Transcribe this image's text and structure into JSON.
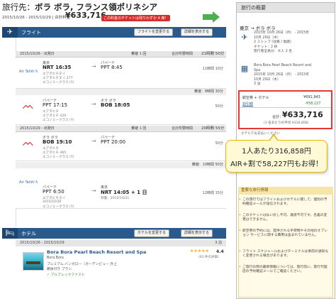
{
  "header": {
    "title_prefix": "旅行先：",
    "title_main": "ボラ ボラ, フランス領ポリネシア",
    "dates": "2015/10/26 - 2015/10/29 | 合計料金",
    "price": "¥633,716",
    "badge": "この料金のチケットは残りわずか 4 席！"
  },
  "flight_section": {
    "label": "フライト",
    "btn_change": "フライトを変更する",
    "btn_details": "詳細を表示する",
    "icon": "airplane-icon"
  },
  "flight_segments": [
    {
      "date": "2015/10/26 - 出発日",
      "stops": "乗継 1 回",
      "total": "合計所要時間",
      "total_time": "21時間 50分",
      "legs": [
        {
          "from_code": "東京",
          "from_time": "NRT 16:35",
          "to_code": "パペーテ",
          "to_time": "PPT 8:45",
          "airline": "エアタヒチヌイ",
          "flight": "エアタヒチヌイ 277",
          "cabin": "エコノミークラス (Y)",
          "duration": "11時間 10分"
        }
      ],
      "layover": "乗継：8時間 30分"
    },
    {
      "legs": [
        {
          "from_code": "パペーテ",
          "from_time": "PPT 17:15",
          "to_code": "ボラ ボラ",
          "to_time": "BOB 18:05",
          "airline": "エアタヒチ",
          "flight": "エアタヒチ 429",
          "cabin": "エコノミークラス (Y)",
          "duration": "50分"
        }
      ]
    },
    {
      "date": "2015/10/29 - 出発日",
      "stops": "乗継 1 回",
      "total": "合計所要時間",
      "total_time": "20時間 55分",
      "legs": [
        {
          "from_code": "ボラ ボラ",
          "from_time": "BOB 19:10",
          "to_code": "パペーテ",
          "to_time": "PPT 20:00",
          "airline": "エアタヒチ",
          "flight": "エアタヒチ 465",
          "cabin": "エコノミークラス (Y)",
          "duration": "50分"
        }
      ],
      "layover": "乗継：10時間 50分"
    },
    {
      "legs": [
        {
          "from_code": "パペーテ",
          "from_time": "PPT 6:50",
          "to_code": "東京",
          "to_time": "NRT 14:05 + 1 日",
          "airline": "エアタヒチヌイ",
          "flight": "2015/10/30",
          "cabin": "エコノミークラス (Y)",
          "duration": "12時間 15分",
          "arrive_note": "到着：2015/10/31"
        }
      ]
    }
  ],
  "hotel_section": {
    "label": "ホテル",
    "btn_change": "ホテルを変更する",
    "btn_details": "詳細を表示する",
    "dates": "2015/10/26 - 2015/10/29",
    "nights": "3 泊",
    "name": "Bora Bora Pearl Beach Resort and Spa",
    "rating": "4.4",
    "city": "Bora Bora",
    "room": "プレミアム バンガロー（ガーデンビュー 外上",
    "meal": "朝食付き プラン",
    "reviews": "(93 件の評価)",
    "breakfast": "ブルブレックファスト"
  },
  "summary": {
    "title": "旅行の概要",
    "route": "東京 → ボラ ボラ",
    "flight_lines": [
      "2015年 10月 26日（月） - 2015年",
      "10月 29日（木）",
      "2 ストップ (往路 / 復路)",
      "チケット：2 枚",
      "旅行者全員分：大人 2 名"
    ],
    "hotel_lines": [
      "Bora Bora Pearl Beach Resort and",
      "Spa",
      "2015年 10月 26日（月） - 2015年",
      "10月 29日（木）",
      "3 泊"
    ],
    "row1_label": "航空券 + ホテル",
    "row1_value": "¥691,943",
    "row2_label": "割引額",
    "row2_value": "-¥58,227",
    "total_label": "合計：",
    "total_value": "¥633,716",
    "per_person": "(1 名あたりの平均 ¥316,858)",
    "note": "ホテルでお支払いください"
  },
  "callout": {
    "line1": "1人あたり316,858円",
    "line2": "AIR+割で58,227円もお得！"
  },
  "notices": {
    "title": "重要な旅行情報",
    "items": [
      "この旅行ではフライトおよびホテルに関して、個別の予約確認メールが送信されます。",
      "このチケットは払い戻し不可、譲渡不可です。名義の変更はできません。",
      "航空券の予約には、提供される手荷物やその他のオプション サービスに関する費用は含まれていません。",
      "フライト スケジュールおよびターミナルは事前の通知なく変更される場合があります。",
      "ご旅行の際の最新情報については、旅行前に、旅行代理店の予約確認メールでご確認ください。"
    ]
  },
  "colors": {
    "section_bar": "#2a5a8c",
    "badge_red": "#d32f2f",
    "highlight_red": "#e53935",
    "green_arrow": "#4caf50",
    "callout_bg": "#fff9d6"
  }
}
